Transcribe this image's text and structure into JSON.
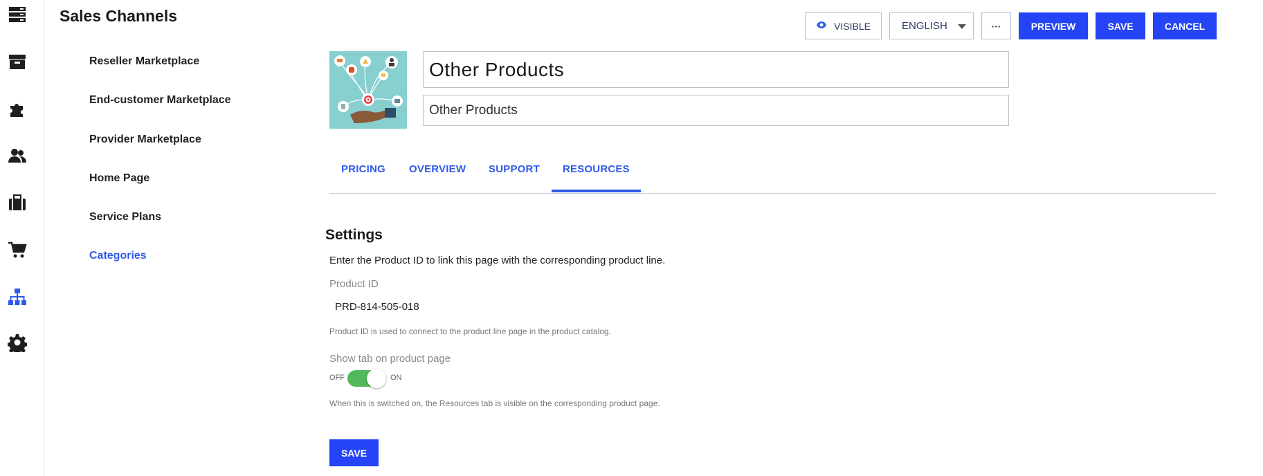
{
  "header": {
    "title": "Sales Channels"
  },
  "rail": {
    "icons": [
      "server-icon",
      "archive-icon",
      "puzzle-icon",
      "users-icon",
      "briefcase-icon",
      "cart-icon",
      "sitemap-icon",
      "gear-icon"
    ],
    "active": "sitemap-icon",
    "color": "#1f1f1f",
    "active_color": "#2f5bea"
  },
  "subnav": {
    "items": [
      {
        "label": "Reseller Marketplace"
      },
      {
        "label": "End-customer Marketplace"
      },
      {
        "label": "Provider Marketplace"
      },
      {
        "label": "Home Page"
      },
      {
        "label": "Service Plans"
      },
      {
        "label": "Categories"
      }
    ],
    "active_index": 5
  },
  "toolbar": {
    "visible_label": "VISIBLE",
    "language_value": "ENGLISH",
    "more_label": "···",
    "preview_label": "PREVIEW",
    "save_label": "SAVE",
    "cancel_label": "CANCEL"
  },
  "product": {
    "title": "Other Products",
    "subtitle": "Other Products"
  },
  "tabs": {
    "items": [
      {
        "label": "PRICING"
      },
      {
        "label": "OVERVIEW"
      },
      {
        "label": "SUPPORT"
      },
      {
        "label": "RESOURCES"
      }
    ],
    "active_index": 3
  },
  "settings": {
    "title": "Settings",
    "description": "Enter the Product ID to link this page with the corresponding product line.",
    "product_id_label": "Product ID",
    "product_id_value": "PRD-814-505-018",
    "product_id_help": "Product ID is used to connect to the product line page in the product catalog.",
    "show_tab_label": "Show tab on product page",
    "toggle_off": "OFF",
    "toggle_on": "ON",
    "toggle_state": true,
    "toggle_help": "When this is switched on, the Resources tab is visible on the corresponding product page.",
    "save_label": "SAVE"
  },
  "colors": {
    "primary": "#2444f5",
    "link": "#2f5bea",
    "toggle_on": "#52b95a"
  }
}
